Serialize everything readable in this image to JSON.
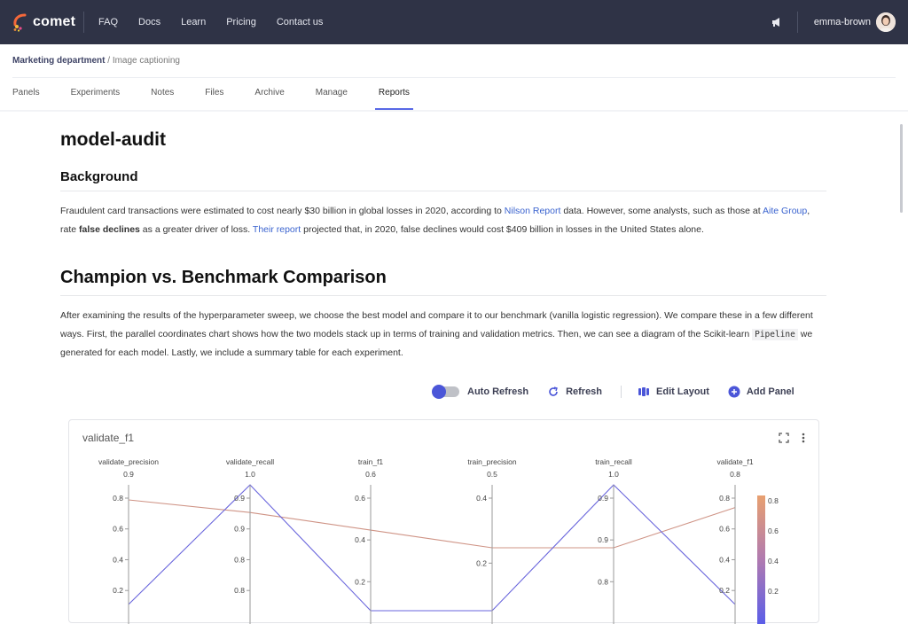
{
  "app": {
    "brand": "comet",
    "nav": [
      "FAQ",
      "Docs",
      "Learn",
      "Pricing",
      "Contact us"
    ],
    "username": "emma-brown"
  },
  "breadcrumb": {
    "workspace": "Marketing department",
    "separator": " / ",
    "project": "Image captioning"
  },
  "tabs": [
    "Panels",
    "Experiments",
    "Notes",
    "Files",
    "Archive",
    "Manage",
    "Reports"
  ],
  "active_tab": "Reports",
  "report": {
    "title": "model-audit",
    "background_heading": "Background",
    "background_p": {
      "t1": "Fraudulent card transactions were estimated to cost nearly $30 billion in global losses in 2020, according to ",
      "link1": "Nilson Report",
      "t2": " data. However, some analysts, such as those at ",
      "link2": "Aite Group",
      "t3": ", rate ",
      "bold": "false declines",
      "t4": " as a greater driver of loss. ",
      "link3": "Their report",
      "t5": " projected that, in 2020, false declines would cost $409 billion in losses in the United States alone."
    },
    "comparison_heading": "Champion vs. Benchmark Comparison",
    "comparison_p": {
      "t1": "After examining the results of the hyperparameter sweep, we choose the best model and compare it to our benchmark (vanilla logistic regression). We compare these in a few different ways. First, the parallel coordinates chart shows how the two models stack up in terms of training and validation metrics. Then, we can see a diagram of the Scikit-learn ",
      "code": "Pipeline",
      "t2": " we generated for each model. Lastly, we include a summary table for each experiment."
    }
  },
  "toolbar": {
    "auto_refresh": "Auto Refresh",
    "refresh": "Refresh",
    "edit_layout": "Edit Layout",
    "add_panel": "Add Panel"
  },
  "panel": {
    "title": "validate_f1",
    "icons": [
      "expand-icon",
      "more-vertical-icon"
    ]
  },
  "colors": {
    "topbar": "#2f3346",
    "accent": "#5869e6",
    "link": "#3a63cf",
    "line_low": "#5b5ee8",
    "line_high": "#e8a070"
  },
  "chart_data": {
    "type": "parallel-coordinates",
    "color_by": "validate_f1",
    "colorbar_ticks": [
      "0.8",
      "0.6",
      "0.4",
      "0.2"
    ],
    "axes": [
      {
        "name": "validate_precision",
        "max_label": "0.9",
        "ticks": [
          "0.8",
          "0.6",
          "0.4",
          "0.2"
        ]
      },
      {
        "name": "validate_recall",
        "max_label": "1.0",
        "ticks": [
          "0.9",
          "0.9",
          "0.8",
          "0.8"
        ]
      },
      {
        "name": "train_f1",
        "max_label": "0.6",
        "ticks": [
          "0.6",
          "0.4",
          "0.2"
        ]
      },
      {
        "name": "train_precision",
        "max_label": "0.5",
        "ticks": [
          "0.4",
          "0.2"
        ]
      },
      {
        "name": "train_recall",
        "max_label": "1.0",
        "ticks": [
          "0.9",
          "0.9",
          "0.8"
        ]
      },
      {
        "name": "validate_f1",
        "max_label": "0.8",
        "ticks": [
          "0.8",
          "0.6",
          "0.4",
          "0.2"
        ]
      }
    ],
    "series": [
      {
        "values": [
          0.88,
          0.78,
          0.64,
          0.5,
          0.5,
          0.82
        ],
        "color_value": 0.82
      },
      {
        "values": [
          0.05,
          1.0,
          0.0,
          0.0,
          1.0,
          0.05
        ],
        "color_value": 0.1
      }
    ]
  }
}
